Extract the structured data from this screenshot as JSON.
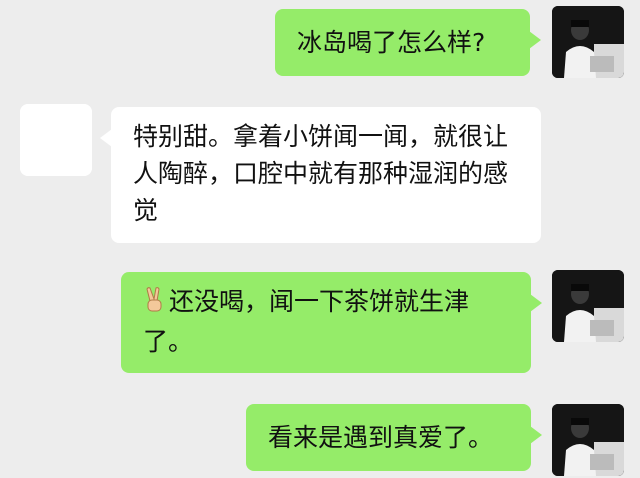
{
  "messages": [
    {
      "side": "right",
      "text": "冰岛喝了怎么样?"
    },
    {
      "side": "left",
      "text": "特别甜。拿着小饼闻一闻，就很让人陶醉，口腔中就有那种湿润的感觉"
    },
    {
      "side": "right",
      "emoji": "victory-hand",
      "text": "还没喝，闻一下茶饼就生津了。"
    },
    {
      "side": "right",
      "text": "看来是遇到真爱了。"
    }
  ],
  "colors": {
    "background": "#ededed",
    "sent_bubble": "#95ec69",
    "received_bubble": "#ffffff",
    "text": "#111111"
  },
  "icons": {
    "self_avatar": "person-photo-avatar",
    "other_avatar": "blank-avatar",
    "emoji": "victory-hand-emoji"
  }
}
